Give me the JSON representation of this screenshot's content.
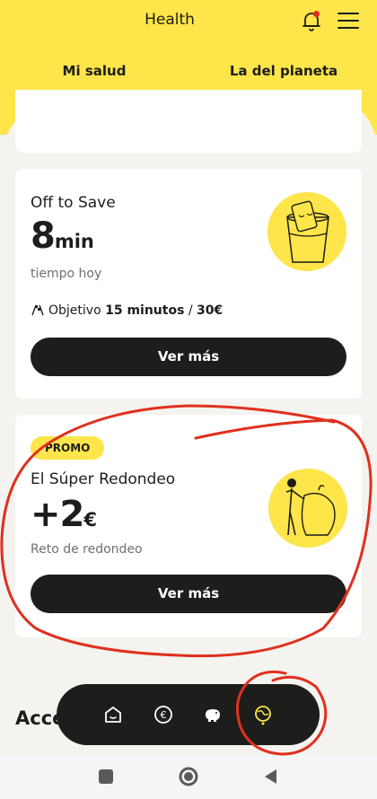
{
  "header": {
    "title": "Health",
    "icons": [
      "bell-icon",
      "menu-icon"
    ],
    "notification_dot_color": "#e32b1e"
  },
  "tabs": [
    {
      "label": "Mi salud",
      "active": true
    },
    {
      "label": "La del planeta",
      "active": false
    }
  ],
  "cards": {
    "off_to_save": {
      "title": "Off to Save",
      "value": "8",
      "unit": "min",
      "subtitle": "tiempo hoy",
      "objective_prefix": "Objetivo",
      "objective_minutes": "15 minutos",
      "objective_sep": " / ",
      "objective_amount": "30€",
      "button_label": "Ver más"
    },
    "super_redondeo": {
      "badge": "PROMO",
      "title": "El Súper Redondeo",
      "value": "+2",
      "unit": "€",
      "subtitle": "Reto de redondeo",
      "button_label": "Ver más"
    }
  },
  "section_partial_title": "Acce",
  "bottom_nav": [
    "home-icon",
    "euro-icon",
    "piggy-bank-icon",
    "health-planet-icon"
  ],
  "colors": {
    "brand_yellow": "#fde54a",
    "dark": "#1d1d1b",
    "annotation_red": "#e0301e"
  }
}
